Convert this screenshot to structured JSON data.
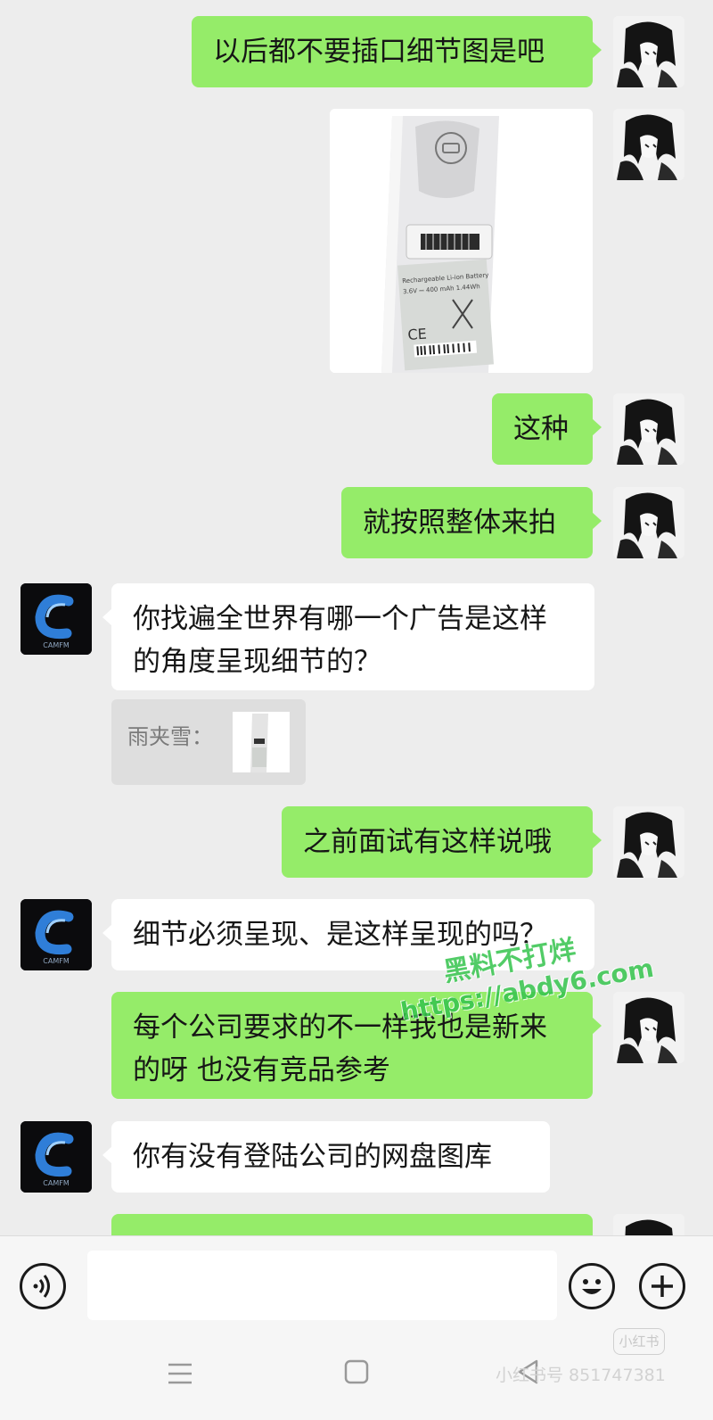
{
  "messages": {
    "m1": "以后都不要插口细节图是吧",
    "m3": "这种",
    "m4": "就按照整体来拍",
    "m5": "你找遍全世界有哪一个广告是这样的角度呈现细节的？",
    "m6_quote": "雨夹雪：",
    "m7": "之前面试有这样说哦",
    "m8": "细节必须呈现、是这样呈现的吗？",
    "m9": "每个公司要求的不一样我也是新来的呀 也没有竞品参考",
    "m10": "你有没有登陆公司的网盘图库"
  },
  "photo_label": {
    "title": "Rechargeable Li-ion Battery",
    "spec": "3.6V ⎓ 400 mAh 1.44Wh",
    "ce": "CE"
  },
  "contact_logo_text": "CAMFM",
  "watermark": {
    "line1": "黑料不打烊",
    "line2": "https://abdy6.com"
  },
  "footer_watermark": {
    "badge": "小红书",
    "text": "小红书号 851747381"
  },
  "colors": {
    "my_bubble": "#95ec69",
    "their_bubble": "#ffffff",
    "background": "#ededed"
  },
  "icons": {
    "voice": "voice-icon",
    "emoji": "emoji-icon",
    "plus": "plus-icon",
    "menu": "nav-menu-icon",
    "home": "nav-home-icon",
    "back": "nav-back-icon"
  }
}
